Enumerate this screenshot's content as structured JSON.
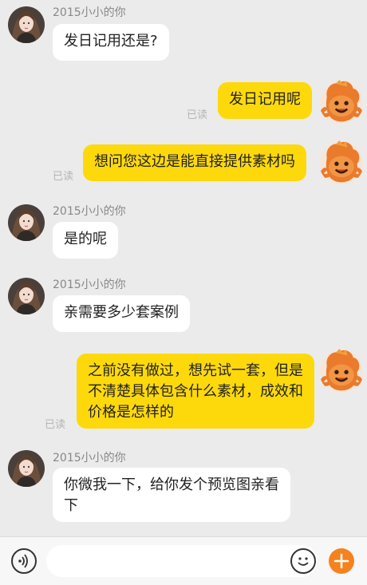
{
  "messages": [
    {
      "sender": "2015小小的你",
      "text": "发日记用还是?"
    },
    {
      "text": "发日记用呢",
      "status": "已读"
    },
    {
      "text": "想问您这边是能直接提供素材吗",
      "status": "已读"
    },
    {
      "sender": "2015小小的你",
      "text": "是的呢"
    },
    {
      "sender": "2015小小的你",
      "text": "亲需要多少套案例"
    },
    {
      "text": "之前没有做过，想先试一套，但是不清楚具体包含什么素材，成效和价格是怎样的",
      "status": "已读"
    },
    {
      "sender": "2015小小的你",
      "text": "你微我一下，给你发个预览图亲看下"
    }
  ],
  "input_bar": {
    "text_value": "",
    "voice_icon": "voice-icon",
    "emoji_icon": "emoji-icon",
    "plus_icon": "plus-icon"
  },
  "colors": {
    "background": "#ebebeb",
    "incoming_bubble": "#ffffff",
    "outgoing_bubble": "#fdd90c",
    "plus_button": "#f5821f"
  }
}
